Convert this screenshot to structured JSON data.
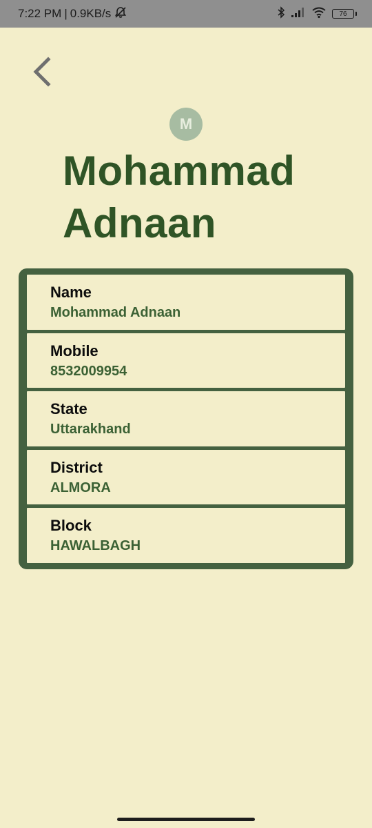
{
  "status_bar": {
    "time": "7:22 PM",
    "separator": "|",
    "network_speed": "0.9KB/s",
    "battery_level": "76",
    "icons": [
      "bell-off-icon",
      "bluetooth-icon",
      "signal-icon",
      "wifi-icon",
      "battery-icon"
    ]
  },
  "header": {
    "back_icon": "chevron-left-icon",
    "avatar_initial": "M",
    "title": "Mohammad Adnaan"
  },
  "details": [
    {
      "label": "Name",
      "value": "Mohammad Adnaan"
    },
    {
      "label": "Mobile",
      "value": "8532009954"
    },
    {
      "label": "State",
      "value": "Uttarakhand"
    },
    {
      "label": "District",
      "value": "ALMORA"
    },
    {
      "label": "Block",
      "value": "HAWALBAGH"
    }
  ],
  "colors": {
    "background": "#f3eeca",
    "accent": "#446140",
    "title": "#2f5426",
    "value_text": "#3b6134",
    "avatar": "#a7bca2"
  }
}
